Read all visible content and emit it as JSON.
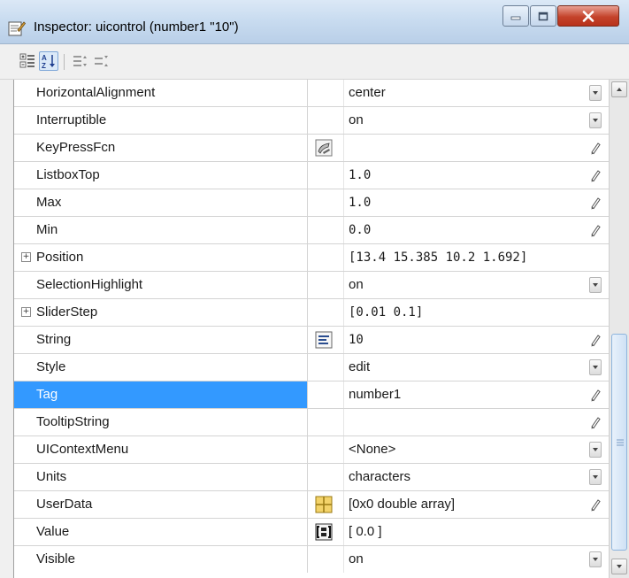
{
  "window": {
    "title": "Inspector:  uicontrol (number1 \"10\")"
  },
  "toolbar": {
    "buttons": [
      "categorized-view",
      "alphabetical-view",
      "expand-all",
      "collapse-all"
    ]
  },
  "properties": [
    {
      "name": "HorizontalAlignment",
      "value": "center",
      "action": "dropdown"
    },
    {
      "name": "Interruptible",
      "value": "on",
      "action": "dropdown"
    },
    {
      "name": "KeyPressFcn",
      "value": "",
      "editor": "callback-editor-icon",
      "action": "edit"
    },
    {
      "name": "ListboxTop",
      "value": "1.0",
      "action": "edit"
    },
    {
      "name": "Max",
      "value": "1.0",
      "action": "edit"
    },
    {
      "name": "Min",
      "value": "0.0",
      "action": "edit"
    },
    {
      "name": "Position",
      "value": "[13.4 15.385 10.2 1.692]",
      "expandable": true
    },
    {
      "name": "SelectionHighlight",
      "value": "on",
      "action": "dropdown"
    },
    {
      "name": "SliderStep",
      "value": "[0.01 0.1]",
      "expandable": true
    },
    {
      "name": "String",
      "value": "10",
      "editor": "text-editor-icon",
      "action": "edit"
    },
    {
      "name": "Style",
      "value": "edit",
      "action": "dropdown"
    },
    {
      "name": "Tag",
      "value": "number1",
      "action": "edit",
      "selected": true
    },
    {
      "name": "TooltipString",
      "value": "",
      "action": "edit"
    },
    {
      "name": "UIContextMenu",
      "value": "<None>",
      "action": "dropdown"
    },
    {
      "name": "Units",
      "value": "characters",
      "action": "dropdown"
    },
    {
      "name": "UserData",
      "value": "[0x0  double array]",
      "editor": "array-editor-icon",
      "action": "edit"
    },
    {
      "name": "Value",
      "value": "[ 0.0 ]",
      "editor": "value-editor-icon"
    },
    {
      "name": "Visible",
      "value": "on",
      "action": "dropdown"
    }
  ],
  "colors": {
    "selection": "#3399ff",
    "grid_line": "#d4d4d4"
  }
}
